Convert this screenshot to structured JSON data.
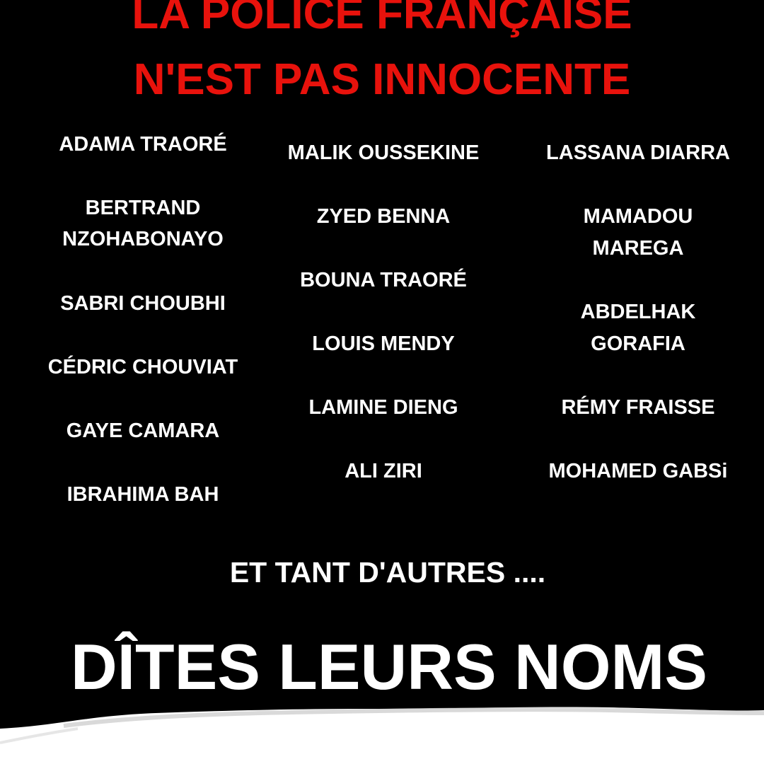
{
  "title": {
    "line1": "LA POLICE FRANÇAISE",
    "line2": "N'EST PAS INNOCENTE"
  },
  "names": {
    "col1": {
      "adama": "ADAMA TRAORÉ",
      "bertrand_1": "BERTRAND",
      "bertrand_2": "NZOHABONAYO",
      "sabri": "SABRI CHOUBHI",
      "cedric": "CÉDRIC CHOUVIAT",
      "gaye": "GAYE CAMARA",
      "ibrahima": "IBRAHIMA BAH"
    },
    "col2": {
      "malik": "MALIK OUSSEKINE",
      "zyed": "ZYED BENNA",
      "bouna": "BOUNA TRAORÉ",
      "louis": "LOUIS MENDY",
      "lamine": "LAMINE DIENG",
      "ali": "ALI ZIRI"
    },
    "col3": {
      "lassana": "LASSANA DIARRA",
      "mamadou_1": "MAMADOU",
      "mamadou_2": "MAREGA",
      "abdelhak_1": "ABDELHAK",
      "abdelhak_2": "GORAFIA",
      "remy": "RÉMY FRAISSE",
      "mohamed": "MOHAMED GABSi"
    }
  },
  "others": "ET TANT D'AUTRES ....",
  "slogan": "DÎTES LEURS NOMS",
  "colors": {
    "background": "#000000",
    "title": "#e8120c",
    "text": "#ffffff",
    "paper": "#ffffff"
  }
}
